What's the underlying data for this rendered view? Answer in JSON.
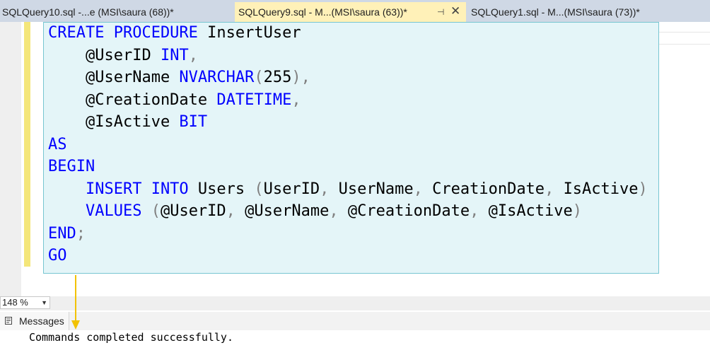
{
  "tabs": [
    {
      "label": "SQLQuery10.sql -...e (MSI\\saura (68))*"
    },
    {
      "label": "SQLQuery9.sql - M...(MSI\\saura (63))*",
      "pin_icon": "pin-icon",
      "close_icon": "close-icon"
    },
    {
      "label": "SQLQuery1.sql - M...(MSI\\saura (73))*"
    }
  ],
  "editor": {
    "lines": [
      [
        {
          "t": "CREATE PROCEDURE",
          "c": "kw"
        },
        {
          "t": " InsertUser",
          "c": "fn"
        }
      ],
      [
        {
          "t": "    @UserID",
          "c": "pa"
        },
        {
          "t": " INT",
          "c": "ty"
        },
        {
          "t": ",",
          "c": "pu"
        }
      ],
      [
        {
          "t": "    @UserName",
          "c": "pa"
        },
        {
          "t": " NVARCHAR",
          "c": "ty"
        },
        {
          "t": "(",
          "c": "pu"
        },
        {
          "t": "255",
          "c": "nm"
        },
        {
          "t": "),",
          "c": "pu"
        }
      ],
      [
        {
          "t": "    @CreationDate",
          "c": "pa"
        },
        {
          "t": " DATETIME",
          "c": "ty"
        },
        {
          "t": ",",
          "c": "pu"
        }
      ],
      [
        {
          "t": "    @IsActive",
          "c": "pa"
        },
        {
          "t": " BIT",
          "c": "ty"
        }
      ],
      [
        {
          "t": "AS",
          "c": "kw"
        }
      ],
      [
        {
          "t": "BEGIN",
          "c": "kw"
        }
      ],
      [
        {
          "t": "    INSERT INTO",
          "c": "kw"
        },
        {
          "t": " Users ",
          "c": "id"
        },
        {
          "t": "(",
          "c": "pu"
        },
        {
          "t": "UserID",
          "c": "id"
        },
        {
          "t": ", ",
          "c": "pu"
        },
        {
          "t": "UserName",
          "c": "id"
        },
        {
          "t": ", ",
          "c": "pu"
        },
        {
          "t": "CreationDate",
          "c": "id"
        },
        {
          "t": ", ",
          "c": "pu"
        },
        {
          "t": "IsActive",
          "c": "id"
        },
        {
          "t": ")",
          "c": "pu"
        }
      ],
      [
        {
          "t": "    VALUES",
          "c": "kw"
        },
        {
          "t": " (",
          "c": "pu"
        },
        {
          "t": "@UserID",
          "c": "pa"
        },
        {
          "t": ", ",
          "c": "pu"
        },
        {
          "t": "@UserName",
          "c": "pa"
        },
        {
          "t": ", ",
          "c": "pu"
        },
        {
          "t": "@CreationDate",
          "c": "pa"
        },
        {
          "t": ", ",
          "c": "pu"
        },
        {
          "t": "@IsActive",
          "c": "pa"
        },
        {
          "t": ")",
          "c": "pu"
        }
      ],
      [
        {
          "t": "END",
          "c": "kw"
        },
        {
          "t": ";",
          "c": "pu"
        }
      ],
      [
        {
          "t": "GO",
          "c": "kw"
        }
      ]
    ]
  },
  "zoom": {
    "value": "148 %",
    "dropdown_icon": "chevron-down-icon"
  },
  "results": {
    "tab_label": "Messages",
    "tab_icon": "messages-icon",
    "message": "Commands completed successfully."
  },
  "colors": {
    "active_tab": "#fff1b8",
    "selection": "#e4f5f8",
    "keyword": "#0000ff",
    "change_bar": "#f4e67a",
    "annotation_arrow": "#f2c200"
  }
}
